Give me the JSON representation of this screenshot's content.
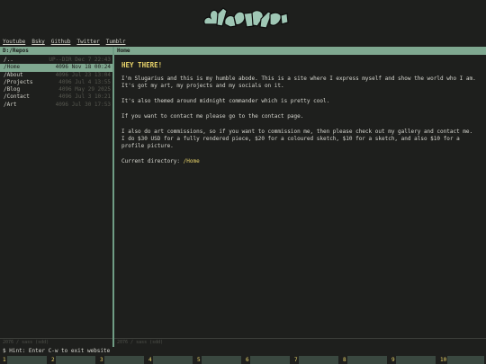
{
  "banner": {
    "logo_text": "Slugarius"
  },
  "socials": [
    "Youtube",
    "Bsky",
    "Github",
    "Twitter",
    "Tumblr"
  ],
  "left_panel": {
    "path": "D:/Repos",
    "entries": [
      {
        "name": "/..",
        "meta": "UP--DIR Dec 7 22:43"
      },
      {
        "name": "/Home",
        "meta": "4096 Nov 18 00:24"
      },
      {
        "name": "/About",
        "meta": "4096 Jul 23 13:04"
      },
      {
        "name": "/Projects",
        "meta": "4096 Jul 4 13:55"
      },
      {
        "name": "/Blog",
        "meta": "4096 May 29 2025"
      },
      {
        "name": "/Contact",
        "meta": "4096 Jul 3 10:21"
      },
      {
        "name": "/Art",
        "meta": "4096 Jul 30 17:53"
      }
    ],
    "selected_index": 1,
    "footer": "2076 / sass (sdd)"
  },
  "right_panel": {
    "title": "Home",
    "heading": "HEY THERE!",
    "paragraphs": [
      "I'm Slugarius and this is my humble abode. This is a site where I express myself and show the world who I am. It's got my art, my projects and my socials on it.",
      "It's also themed around midnight commander which is pretty cool.",
      "If you want to contact me please go to the contact page.",
      "I also do art commissions, so if you want to commission me, then please check out my gallery and contact me. I do $30 USD for a fully rendered piece, $20 for a coloured sketch, $10 for a sketch, and also $10 for a profile picture."
    ],
    "current_dir_label": "Current directory:",
    "current_dir_value": "/Home",
    "footer": "2076 / sass (sdd)"
  },
  "hint": {
    "prompt": "$",
    "text": "Hint: Enter C-w to exit website"
  },
  "fkeys": [
    "1",
    "2",
    "3",
    "4",
    "5",
    "6",
    "7",
    "8",
    "9",
    "10"
  ],
  "colors": {
    "accent": "#7fa890",
    "highlight": "#e8d36a",
    "background": "#1e1f1d"
  }
}
